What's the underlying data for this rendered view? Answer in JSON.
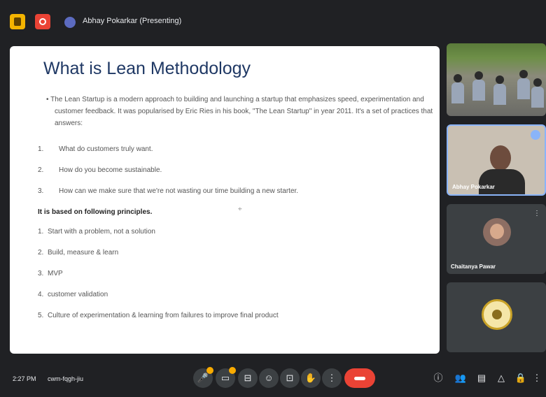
{
  "presenting": {
    "label": "Abhay Pokarkar (Presenting)"
  },
  "slide": {
    "title": "What is Lean Methodology",
    "intro": "The Lean Startup is a modern approach to building and launching a startup that emphasizes speed, experimentation and customer feedback. It was popularised by Eric Ries in his book, \"The Lean Startup\" in year 2011. It's a set of practices that answers:",
    "questions": [
      {
        "num": "1.",
        "text": "What do customers truly want."
      },
      {
        "num": "2.",
        "text": "How do you become sustainable."
      },
      {
        "num": "3.",
        "text": "How can we make sure that we're not wasting our time building a new starter."
      }
    ],
    "principles_heading": "It is based on following principles.",
    "principles": [
      {
        "num": "1.",
        "text": "Start with a problem, not a solution"
      },
      {
        "num": "2.",
        "text": "Build, measure & learn"
      },
      {
        "num": "3.",
        "text": "MVP"
      },
      {
        "num": "4.",
        "text": "customer validation"
      },
      {
        "num": "5.",
        "text": "Culture of experimentation & learning from failures to improve final product"
      }
    ]
  },
  "participants": [
    {
      "name": ""
    },
    {
      "name": "Abhay Pokarkar"
    },
    {
      "name": "Chaitanya Pawar"
    },
    {
      "name": ""
    }
  ],
  "footer": {
    "time": "2:27 PM",
    "meeting_code": "cwm-fqgh-jiu"
  },
  "colors": {
    "background": "#202124",
    "tile": "#3c4043",
    "end_call": "#ea4335",
    "accent": "#f9ab00",
    "title": "#1f3864"
  },
  "icons": {
    "controls": [
      "mic-icon",
      "camera-icon",
      "captions-icon",
      "emoji-icon",
      "present-icon",
      "raise-hand-icon",
      "more-options-icon",
      "end-call-icon"
    ],
    "right": [
      "info-icon",
      "people-icon",
      "chat-icon",
      "activities-icon",
      "host-controls-icon"
    ]
  }
}
